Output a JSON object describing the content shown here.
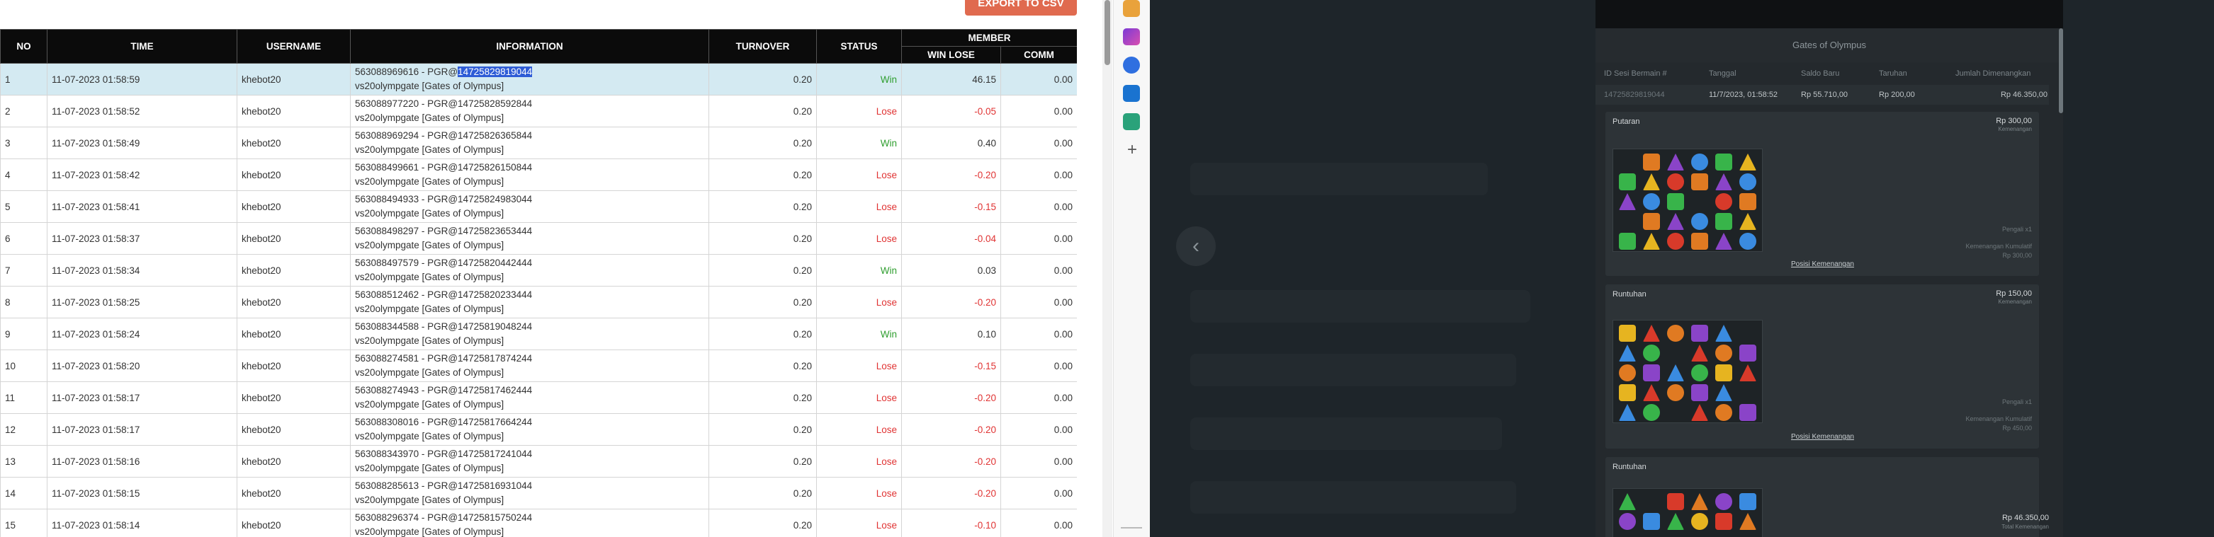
{
  "report": {
    "export_label": "EXPORT TO CSV",
    "headers": {
      "no": "NO",
      "time": "TIME",
      "username": "USERNAME",
      "information": "INFORMATION",
      "turnover": "TURNOVER",
      "status": "STATUS",
      "member": "MEMBER",
      "win_lose": "WIN LOSE",
      "comm": "COMM"
    },
    "rows": [
      {
        "no": "1",
        "time": "11-07-2023 01:58:59",
        "user": "khebot20",
        "info_prefix": "563088969616 - PGR@",
        "info_sel": "14725829819044",
        "info_line2": "vs20olympgate [Gates of Olympus]",
        "turnover": "0.20",
        "status": "Win",
        "winlose": "46.15",
        "comm": "0.00"
      },
      {
        "no": "2",
        "time": "11-07-2023 01:58:52",
        "user": "khebot20",
        "info_prefix": "563088977220 - PGR@14725828592844",
        "info_sel": "",
        "info_line2": "vs20olympgate [Gates of Olympus]",
        "turnover": "0.20",
        "status": "Lose",
        "winlose": "-0.05",
        "comm": "0.00"
      },
      {
        "no": "3",
        "time": "11-07-2023 01:58:49",
        "user": "khebot20",
        "info_prefix": "563088969294 - PGR@14725826365844",
        "info_sel": "",
        "info_line2": "vs20olympgate [Gates of Olympus]",
        "turnover": "0.20",
        "status": "Win",
        "winlose": "0.40",
        "comm": "0.00"
      },
      {
        "no": "4",
        "time": "11-07-2023 01:58:42",
        "user": "khebot20",
        "info_prefix": "563088499661 - PGR@14725826150844",
        "info_sel": "",
        "info_line2": "vs20olympgate [Gates of Olympus]",
        "turnover": "0.20",
        "status": "Lose",
        "winlose": "-0.20",
        "comm": "0.00"
      },
      {
        "no": "5",
        "time": "11-07-2023 01:58:41",
        "user": "khebot20",
        "info_prefix": "563088494933 - PGR@14725824983044",
        "info_sel": "",
        "info_line2": "vs20olympgate [Gates of Olympus]",
        "turnover": "0.20",
        "status": "Lose",
        "winlose": "-0.15",
        "comm": "0.00"
      },
      {
        "no": "6",
        "time": "11-07-2023 01:58:37",
        "user": "khebot20",
        "info_prefix": "563088498297 - PGR@14725823653444",
        "info_sel": "",
        "info_line2": "vs20olympgate [Gates of Olympus]",
        "turnover": "0.20",
        "status": "Lose",
        "winlose": "-0.04",
        "comm": "0.00"
      },
      {
        "no": "7",
        "time": "11-07-2023 01:58:34",
        "user": "khebot20",
        "info_prefix": "563088497579 - PGR@14725820442444",
        "info_sel": "",
        "info_line2": "vs20olympgate [Gates of Olympus]",
        "turnover": "0.20",
        "status": "Win",
        "winlose": "0.03",
        "comm": "0.00"
      },
      {
        "no": "8",
        "time": "11-07-2023 01:58:25",
        "user": "khebot20",
        "info_prefix": "563088512462 - PGR@14725820233444",
        "info_sel": "",
        "info_line2": "vs20olympgate [Gates of Olympus]",
        "turnover": "0.20",
        "status": "Lose",
        "winlose": "-0.20",
        "comm": "0.00"
      },
      {
        "no": "9",
        "time": "11-07-2023 01:58:24",
        "user": "khebot20",
        "info_prefix": "563088344588 - PGR@14725819048244",
        "info_sel": "",
        "info_line2": "vs20olympgate [Gates of Olympus]",
        "turnover": "0.20",
        "status": "Win",
        "winlose": "0.10",
        "comm": "0.00"
      },
      {
        "no": "10",
        "time": "11-07-2023 01:58:20",
        "user": "khebot20",
        "info_prefix": "563088274581 - PGR@14725817874244",
        "info_sel": "",
        "info_line2": "vs20olympgate [Gates of Olympus]",
        "turnover": "0.20",
        "status": "Lose",
        "winlose": "-0.15",
        "comm": "0.00"
      },
      {
        "no": "11",
        "time": "11-07-2023 01:58:17",
        "user": "khebot20",
        "info_prefix": "563088274943 - PGR@14725817462444",
        "info_sel": "",
        "info_line2": "vs20olympgate [Gates of Olympus]",
        "turnover": "0.20",
        "status": "Lose",
        "winlose": "-0.20",
        "comm": "0.00"
      },
      {
        "no": "12",
        "time": "11-07-2023 01:58:17",
        "user": "khebot20",
        "info_prefix": "563088308016 - PGR@14725817664244",
        "info_sel": "",
        "info_line2": "vs20olympgate [Gates of Olympus]",
        "turnover": "0.20",
        "status": "Lose",
        "winlose": "-0.20",
        "comm": "0.00"
      },
      {
        "no": "13",
        "time": "11-07-2023 01:58:16",
        "user": "khebot20",
        "info_prefix": "563088343970 - PGR@14725817241044",
        "info_sel": "",
        "info_line2": "vs20olympgate [Gates of Olympus]",
        "turnover": "0.20",
        "status": "Lose",
        "winlose": "-0.20",
        "comm": "0.00"
      },
      {
        "no": "14",
        "time": "11-07-2023 01:58:15",
        "user": "khebot20",
        "info_prefix": "563088285613 - PGR@14725816931044",
        "info_sel": "",
        "info_line2": "vs20olympgate [Gates of Olympus]",
        "turnover": "0.20",
        "status": "Lose",
        "winlose": "-0.20",
        "comm": "0.00"
      },
      {
        "no": "15",
        "time": "11-07-2023 01:58:14",
        "user": "khebot20",
        "info_prefix": "563088296374 - PGR@14725815750244",
        "info_sel": "",
        "info_line2": "vs20olympgate [Gates of Olympus]",
        "turnover": "0.20",
        "status": "Lose",
        "winlose": "-0.10",
        "comm": "0.00"
      }
    ]
  },
  "sidebar": {
    "icons": [
      "gift-icon",
      "games-icon",
      "copilot-icon",
      "outlook-icon",
      "shopping-icon"
    ],
    "add_label": "+"
  },
  "overlay": {
    "back_icon": "‹"
  },
  "modal": {
    "title": "Gates of Olympus",
    "headers": {
      "id": "ID Sesi Bermain #",
      "date": "Tanggal",
      "balance": "Saldo Baru",
      "bet": "Taruhan",
      "win": "Jumlah Dimenangkan"
    },
    "row": {
      "id": "14725829819044",
      "date": "11/7/2023, 01:58:52",
      "balance": "Rp 55.710,00",
      "bet": "Rp 200,00",
      "win": "Rp 46.350,00"
    },
    "cards": [
      {
        "title": "Putaran",
        "amount": "Rp 300,00",
        "amount_sub": "Kemenangan",
        "link": "Posisi Kemenangan",
        "note1": "Pengali x1",
        "note2": "Kemenangan Kumulatif",
        "note3": "Rp 300,00"
      },
      {
        "title": "Runtuhan",
        "amount": "Rp 150,00",
        "amount_sub": "Kemenangan",
        "link": "Posisi Kemenangan",
        "note1": "Pengali x1",
        "note2": "Kemenangan Kumulatif",
        "note3": "Rp 450,00"
      },
      {
        "title": "Runtuhan",
        "amount": "",
        "amount_sub": "",
        "link": "",
        "note1": "",
        "note2": "",
        "note3": ""
      }
    ],
    "bottom_win": "Rp 46.350,00",
    "bottom_win_sub": "Total Kemenangan"
  }
}
